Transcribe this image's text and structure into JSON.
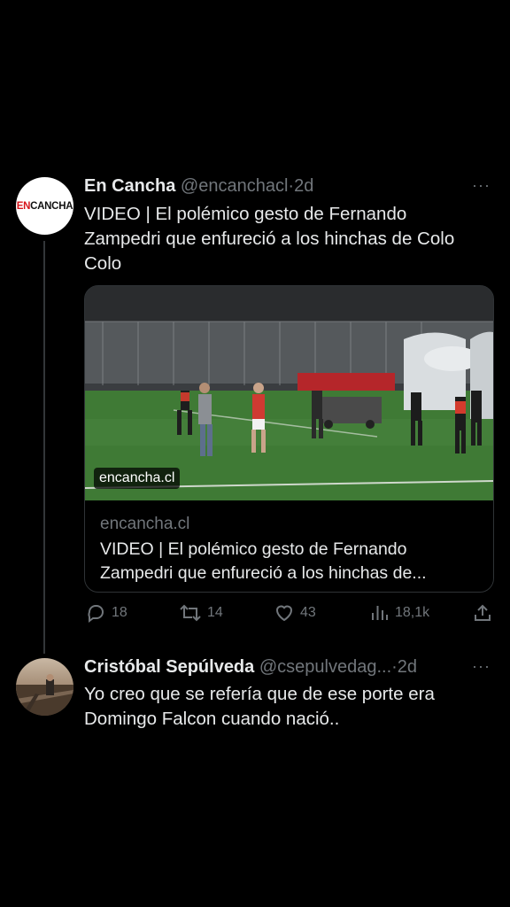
{
  "tweet1": {
    "avatar_text_en": "EN",
    "avatar_text_cancha": "CANCHA",
    "display_name": "En Cancha",
    "handle": "@encanchacl",
    "separator": "·",
    "time": "2d",
    "more": "···",
    "text_line1": "VIDEO | El polémico gesto de Fernando",
    "text_line2": "Zampedri que enfureció a los hinchas de Colo",
    "text_line3": "Colo",
    "card": {
      "overlay_domain": "encancha.cl",
      "domain": "encancha.cl",
      "title_line1": "VIDEO | El polémico gesto de Fernando",
      "title_line2": "Zampedri que enfureció a los hinchas de..."
    },
    "actions": {
      "replies": "18",
      "retweets": "14",
      "likes": "43",
      "views": "18,1k"
    }
  },
  "tweet2": {
    "display_name": "Cristóbal Sepúlveda",
    "handle": "@csepulvedag...",
    "separator": "·",
    "time": "2d",
    "more": "···",
    "text_line1": "Yo creo que se refería que de ese porte era",
    "text_line2": "Domingo Falcon cuando nació.."
  },
  "colors": {
    "background": "#000000",
    "text": "#e7e9ea",
    "muted": "#71767b",
    "brand_red": "#d7141a",
    "pitch_green": "#3f7a35"
  }
}
